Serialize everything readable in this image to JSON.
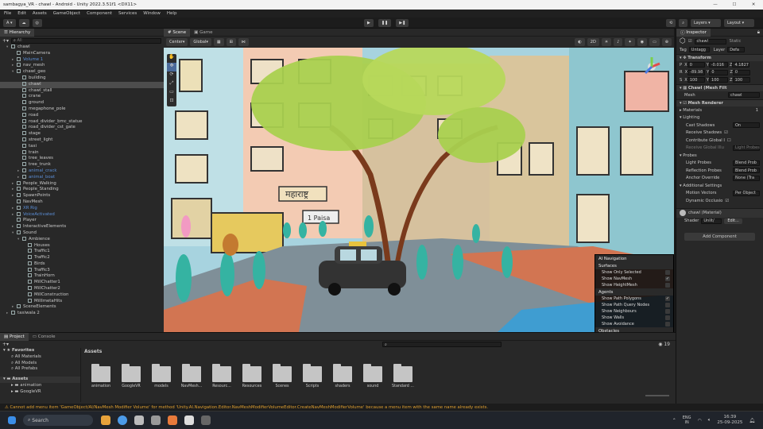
{
  "window": {
    "title": "sambagya_VR - chawl - Android - Unity 2022.3.51f1 <DX11>"
  },
  "menu": [
    "File",
    "Edit",
    "Assets",
    "GameObject",
    "Component",
    "Services",
    "Window",
    "Help"
  ],
  "toolbar": {
    "account": "A",
    "layers": "Layers",
    "layout": "Layout"
  },
  "hierarchy": {
    "tab": "Hierarchy",
    "search_placeholder": "All",
    "items": [
      {
        "label": "chawl",
        "indent": 0,
        "arrow": "▾",
        "blue": false,
        "sel": false
      },
      {
        "label": "MainCamera",
        "indent": 1,
        "arrow": "",
        "blue": false,
        "sel": false
      },
      {
        "label": "Volume 1",
        "indent": 1,
        "arrow": "▸",
        "blue": true,
        "sel": false
      },
      {
        "label": "nav_mesh",
        "indent": 1,
        "arrow": "▸",
        "blue": false,
        "sel": false
      },
      {
        "label": "chawl_geo",
        "indent": 1,
        "arrow": "▾",
        "blue": false,
        "sel": false
      },
      {
        "label": "building",
        "indent": 2,
        "arrow": "",
        "blue": false,
        "sel": false
      },
      {
        "label": "chawl",
        "indent": 2,
        "arrow": "",
        "blue": false,
        "sel": true
      },
      {
        "label": "chawl_stall",
        "indent": 2,
        "arrow": "",
        "blue": false,
        "sel": false
      },
      {
        "label": "crane",
        "indent": 2,
        "arrow": "",
        "blue": false,
        "sel": false
      },
      {
        "label": "ground",
        "indent": 2,
        "arrow": "",
        "blue": false,
        "sel": false
      },
      {
        "label": "megaphone_pole",
        "indent": 2,
        "arrow": "",
        "blue": false,
        "sel": false
      },
      {
        "label": "road",
        "indent": 2,
        "arrow": "",
        "blue": false,
        "sel": false
      },
      {
        "label": "road_divider_bmc_statue",
        "indent": 2,
        "arrow": "",
        "blue": false,
        "sel": false
      },
      {
        "label": "road_divider_cst_gate",
        "indent": 2,
        "arrow": "",
        "blue": false,
        "sel": false
      },
      {
        "label": "stage",
        "indent": 2,
        "arrow": "",
        "blue": false,
        "sel": false
      },
      {
        "label": "street_light",
        "indent": 2,
        "arrow": "",
        "blue": false,
        "sel": false
      },
      {
        "label": "taxi",
        "indent": 2,
        "arrow": "",
        "blue": false,
        "sel": false
      },
      {
        "label": "train",
        "indent": 2,
        "arrow": "",
        "blue": false,
        "sel": false
      },
      {
        "label": "tree_leaves",
        "indent": 2,
        "arrow": "",
        "blue": false,
        "sel": false
      },
      {
        "label": "tree_trunk",
        "indent": 2,
        "arrow": "",
        "blue": false,
        "sel": false
      },
      {
        "label": "animal_crack",
        "indent": 2,
        "arrow": "▸",
        "blue": true,
        "sel": false
      },
      {
        "label": "animal_boat",
        "indent": 2,
        "arrow": "▸",
        "blue": true,
        "sel": false
      },
      {
        "label": "People_Walking",
        "indent": 1,
        "arrow": "▸",
        "blue": false,
        "sel": false
      },
      {
        "label": "People_Standing",
        "indent": 1,
        "arrow": "▸",
        "blue": false,
        "sel": false
      },
      {
        "label": "SpawnPoints",
        "indent": 1,
        "arrow": "▸",
        "blue": false,
        "sel": false
      },
      {
        "label": "NavMesh",
        "indent": 1,
        "arrow": "",
        "blue": false,
        "sel": false
      },
      {
        "label": "XR Rig",
        "indent": 1,
        "arrow": "▸",
        "blue": true,
        "sel": false
      },
      {
        "label": "VoiceActivated",
        "indent": 1,
        "arrow": "▸",
        "blue": true,
        "sel": false
      },
      {
        "label": "Player",
        "indent": 1,
        "arrow": "",
        "blue": false,
        "sel": false
      },
      {
        "label": "InteractiveElements",
        "indent": 1,
        "arrow": "▸",
        "blue": false,
        "sel": false
      },
      {
        "label": "Sound",
        "indent": 1,
        "arrow": "▾",
        "blue": false,
        "sel": false
      },
      {
        "label": "Ambience",
        "indent": 2,
        "arrow": "▾",
        "blue": false,
        "sel": false
      },
      {
        "label": "Houses",
        "indent": 3,
        "arrow": "",
        "blue": false,
        "sel": false
      },
      {
        "label": "Traffic1",
        "indent": 3,
        "arrow": "",
        "blue": false,
        "sel": false
      },
      {
        "label": "Traffic2",
        "indent": 3,
        "arrow": "",
        "blue": false,
        "sel": false
      },
      {
        "label": "Birds",
        "indent": 3,
        "arrow": "",
        "blue": false,
        "sel": false
      },
      {
        "label": "Traffic3",
        "indent": 3,
        "arrow": "",
        "blue": false,
        "sel": false
      },
      {
        "label": "TrainHorn",
        "indent": 3,
        "arrow": "",
        "blue": false,
        "sel": false
      },
      {
        "label": "MillChatter1",
        "indent": 3,
        "arrow": "",
        "blue": false,
        "sel": false
      },
      {
        "label": "MillChatter2",
        "indent": 3,
        "arrow": "",
        "blue": false,
        "sel": false
      },
      {
        "label": "MillConstruction",
        "indent": 3,
        "arrow": "",
        "blue": false,
        "sel": false
      },
      {
        "label": "MillImetaHits",
        "indent": 3,
        "arrow": "",
        "blue": false,
        "sel": false
      },
      {
        "label": "SceneElements",
        "indent": 1,
        "arrow": "▸",
        "blue": false,
        "sel": false
      },
      {
        "label": "taxiwala 2",
        "indent": 0,
        "arrow": "▸",
        "blue": false,
        "sel": false
      }
    ]
  },
  "scene": {
    "tabs": [
      "Scene",
      "Game"
    ],
    "pivot": "Center",
    "space": "Global",
    "mode2d": "2D"
  },
  "navigation": {
    "title": "AI Navigation",
    "sections": [
      {
        "head": "Surfaces",
        "rows": [
          {
            "label": "Show Only Selected",
            "on": false
          },
          {
            "label": "Show NavMesh",
            "on": true
          },
          {
            "label": "Show HeightMesh",
            "on": false
          }
        ]
      },
      {
        "head": "Agents",
        "rows": [
          {
            "label": "Show Path Polygons",
            "on": true
          },
          {
            "label": "Show Path Query Nodes",
            "on": false
          },
          {
            "label": "Show Neighbours",
            "on": false
          },
          {
            "label": "Show Walls",
            "on": false
          },
          {
            "label": "Show Avoidance",
            "on": false
          }
        ]
      },
      {
        "head": "Obstacles",
        "rows": [
          {
            "label": "Show Carve Hull",
            "on": false
          }
        ]
      }
    ]
  },
  "inspector": {
    "tab": "Inspector",
    "name": "chawl",
    "static": "Static",
    "tag_label": "Tag",
    "tag": "Untagg",
    "layer_label": "Layer",
    "layer": "Defa",
    "transform": "Transform",
    "position": {
      "label": "P",
      "x": "0",
      "y": "-0.016",
      "z": "4.1827"
    },
    "rotation": {
      "label": "R",
      "x": "-89.98",
      "y": "0",
      "z": "0"
    },
    "scale": {
      "label": "S",
      "x": "100",
      "y": "100",
      "z": "100"
    },
    "meshfilter": "Chawl (Mesh Filt",
    "mesh_label": "Mesh",
    "mesh": "chawl",
    "renderer": "Mesh Renderer",
    "materials": "Materials",
    "materials_count": "1",
    "lighting": "Lighting",
    "cast_shadows": "Cast Shadows",
    "cast_val": "On",
    "receive_shadows": "Receive Shadows",
    "contribute_gi": "Contribute Global I",
    "receive_gi": "Receive Global Illu",
    "receive_gi_val": "Light Probes",
    "probes": "Probes",
    "light_probes": "Light Probes",
    "light_probes_val": "Blend Prob",
    "reflection_probes": "Reflection Probes",
    "reflection_val": "Blend Prob",
    "anchor": "Anchor Override",
    "anchor_val": "None (Tra",
    "additional": "Additional Settings",
    "motion": "Motion Vectors",
    "motion_val": "Per Object",
    "occlusion": "Dynamic Occlusio",
    "material": "chawl (Material)",
    "shader_label": "Shader",
    "shader": "Unlit/",
    "edit": "Edit...",
    "add_component": "Add Component"
  },
  "project": {
    "tabs": [
      "Project",
      "Console"
    ],
    "favorites": "Favorites",
    "fav_items": [
      "All Materials",
      "All Models",
      "All Prefabs"
    ],
    "assets_root": "Assets",
    "tree_items": [
      "animation",
      "GoogleVR"
    ],
    "breadcrumb": "Assets",
    "count": "19",
    "folders": [
      "animation",
      "GoogleVR",
      "models",
      "NavMesh...",
      "Resourc...",
      "Resources",
      "Scenes",
      "Scripts",
      "shaders",
      "sound",
      "Standard ..."
    ]
  },
  "status": "Cannot add menu item 'GameObject/AI/NavMesh Modifier Volume' for method 'Unity.AI.Navigation.Editor.NavMeshModifierVolumeEditor.CreateNavMeshModifierVolume' because a menu item with the same name already exists.",
  "taskbar": {
    "search": "Search",
    "lang1": "ENG",
    "lang2": "IN",
    "time": "16:39",
    "date": "25-09-2025"
  },
  "scene_signs": {
    "shop": "महाराष्ट्र",
    "sign2": "1 Paisa"
  }
}
